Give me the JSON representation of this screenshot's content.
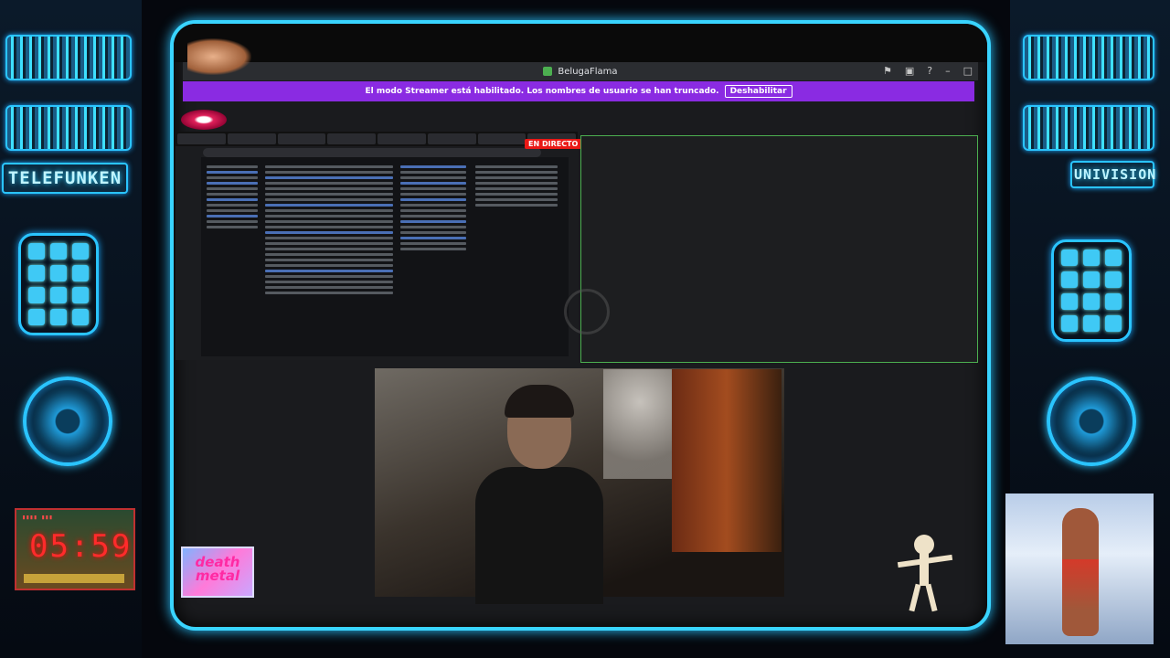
{
  "window": {
    "title": "BelugaFlama",
    "icons": [
      "flag-icon",
      "inbox-icon",
      "help-icon",
      "minimize-icon",
      "maximize-icon"
    ]
  },
  "streamer_banner": {
    "message": "El modo Streamer está habilitado. Los nombres de usuario se han truncado.",
    "button_label": "Deshabilitar"
  },
  "live_badge": "EN DIRECTO",
  "overlay": {
    "brand_left": "TELEFUNKEN",
    "brand_right": "UNIVISION",
    "clock_digits": "05:59",
    "sticker_text": "death metal"
  },
  "colors": {
    "neon": "#27c8ff",
    "banner": "#8a2be2",
    "live": "#e91916",
    "stream_border": "#4caf50"
  }
}
